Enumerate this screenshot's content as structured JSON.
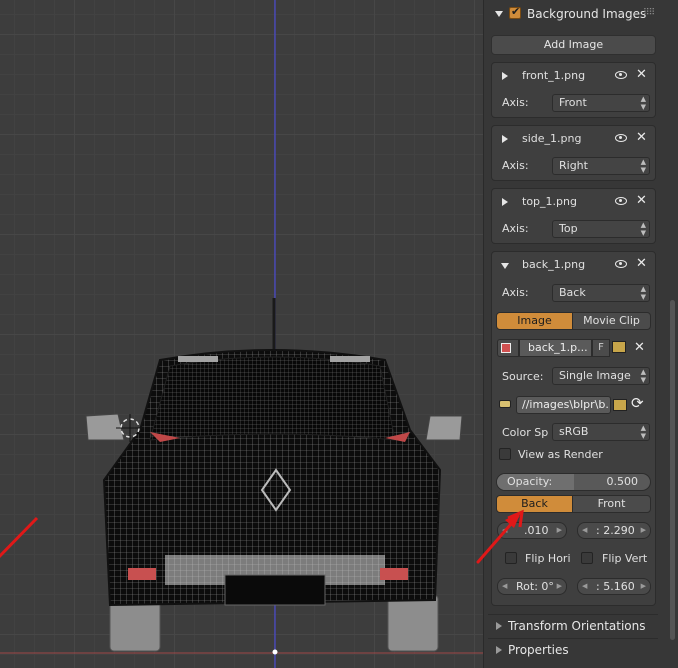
{
  "panel": {
    "section_title": "Background Images",
    "add_image": "Add Image",
    "images": [
      {
        "name": "front_1.png",
        "axis_label": "Axis:",
        "axis": "Front"
      },
      {
        "name": "side_1.png",
        "axis_label": "Axis:",
        "axis": "Right"
      },
      {
        "name": "top_1.png",
        "axis_label": "Axis:",
        "axis": "Top"
      }
    ],
    "expanded": {
      "name": "back_1.png",
      "axis_label": "Axis:",
      "axis": "Back",
      "source_tabs": [
        "Image",
        "Movie Clip"
      ],
      "image_name": "back_1.p...",
      "fake_user": "F",
      "source_label": "Source:",
      "source": "Single Image",
      "filepath": "//images\\blpr\\b...",
      "color_space_label": "Color Sp",
      "color_space": "sRGB",
      "view_as_render": "View as Render",
      "opacity_label": "Opacity:",
      "opacity": "0.500",
      "opacity_fraction": 0.5,
      "draw_tabs": [
        "Back",
        "Front"
      ],
      "offset_x": ".010",
      "size": ": 2.290",
      "flip_h": "Flip Hori",
      "flip_v": "Flip Vert",
      "rotation": "Rot: 0°",
      "scale": ": 5.160"
    },
    "collapsed_sections": [
      "Transform Orientations",
      "Properties"
    ]
  },
  "colors": {
    "accent": "#d08c3a",
    "panel_bg": "#373737",
    "viewport_bg": "#3d3d3d",
    "arrow": "#e01818"
  }
}
